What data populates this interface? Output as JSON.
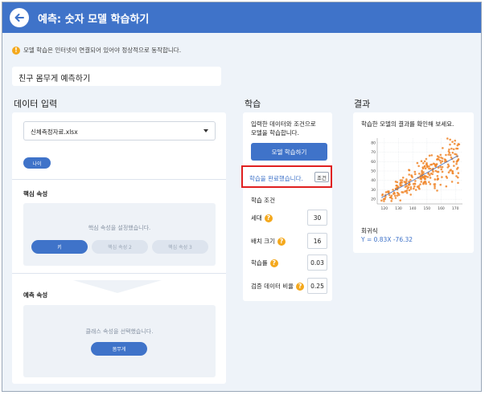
{
  "header": {
    "title": "예측: 숫자 모델 학습하기"
  },
  "notice": {
    "text": "모델 학습은 인터넷이 연결되어 있어야 정상적으로 동작합니다."
  },
  "project": {
    "name": "친구 몸무게 예측하기"
  },
  "sections": {
    "data_input": "데이터 입력",
    "training": "학습",
    "result": "결과"
  },
  "data_input": {
    "file_select": "신체측정자료.xlsx",
    "column_chip": "나이",
    "core_attr_label": "핵심 속성",
    "core_attr_hint": "핵심 속성을 설정했습니다.",
    "core_chips": [
      "키",
      "핵심 속성 2",
      "핵심 속성 3"
    ],
    "predict_attr_label": "예측 속성",
    "predict_hint": "클래스 속성을 선택했습니다.",
    "predict_chip": "몸무게"
  },
  "training": {
    "description": "입력한 데이터와 조건으로 모델을 학습합니다.",
    "description_lines": [
      "입력한 데이터와 조건으로",
      "모델을 학습합니다."
    ],
    "train_button": "모델 학습하기",
    "status": "학습을 완료했습니다.",
    "condition_button": "조건",
    "conditions_title": "학습 조건",
    "params": [
      {
        "label": "세대",
        "value": "30"
      },
      {
        "label": "배치 크기",
        "value": "16"
      },
      {
        "label": "학습률",
        "value": "0.03"
      },
      {
        "label": "검증 데이터 비율",
        "value": "0.25"
      }
    ]
  },
  "result": {
    "description": "학습한 모델의 결과를 확인해 보세요.",
    "regression_label": "회귀식",
    "regression_equation": "Y = 0.83X -76.32"
  },
  "chart_data": {
    "type": "scatter",
    "x_ticks": [
      "120",
      "130",
      "140",
      "150",
      "160",
      "170"
    ],
    "y_ticks": [
      "20",
      "30",
      "40",
      "50",
      "60",
      "70",
      "80"
    ],
    "xlim": [
      115,
      175
    ],
    "ylim": [
      15,
      85
    ],
    "regression": {
      "slope": 0.83,
      "intercept": -76.32
    },
    "point_color": "#f0862a",
    "line_color": "#4a6fb5"
  },
  "colors": {
    "accent": "#3f73c9",
    "highlight_border": "#e02020",
    "warning": "#f4a81c"
  }
}
